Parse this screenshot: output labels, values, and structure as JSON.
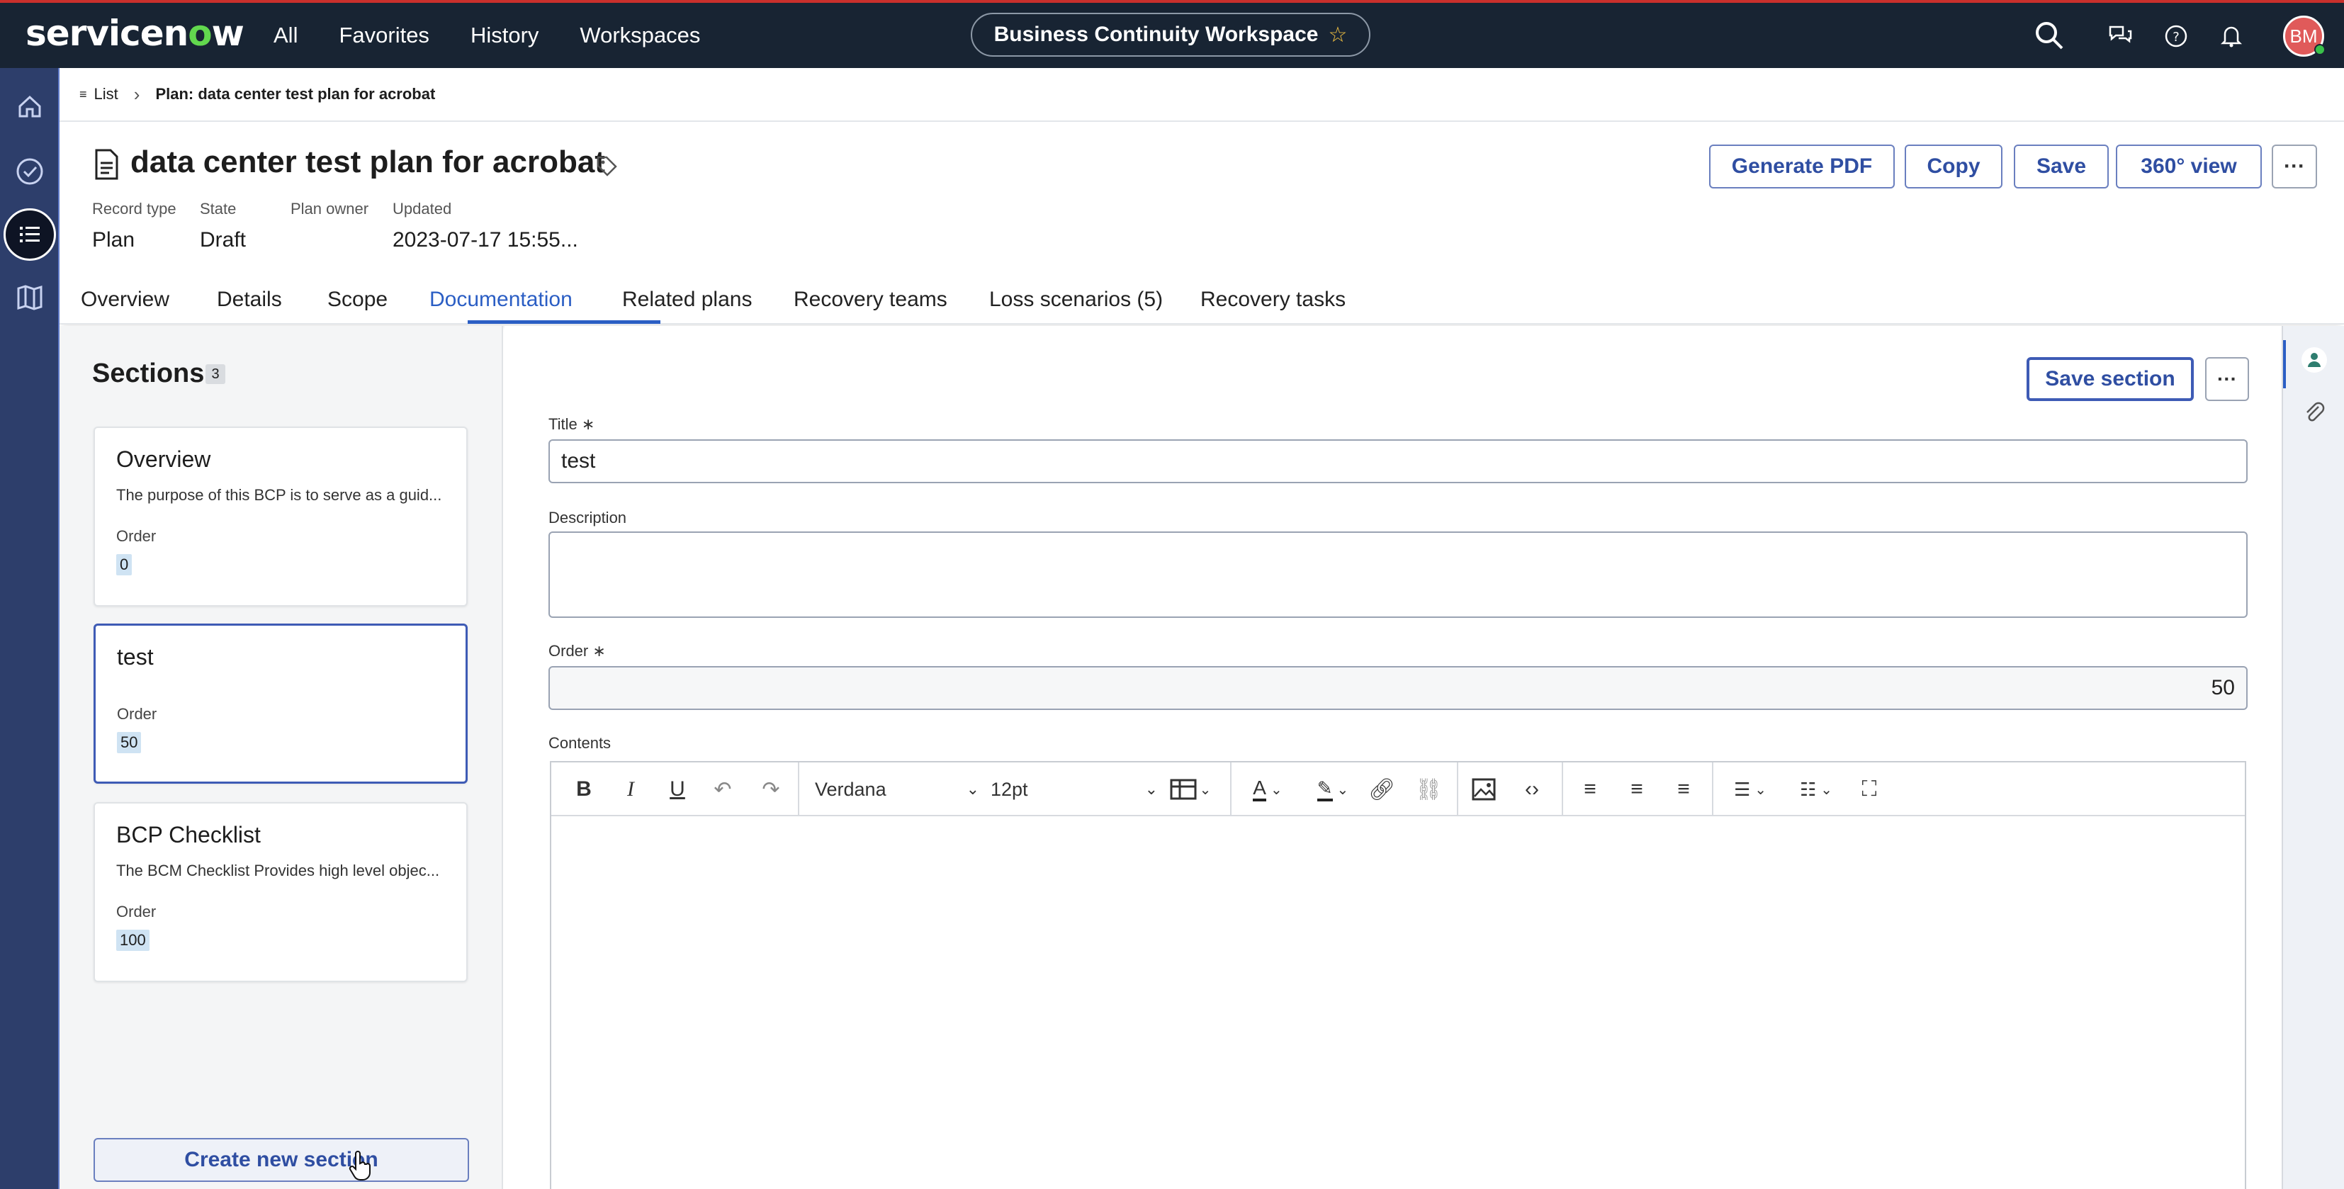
{
  "topbar": {
    "logo_text": "servicenow",
    "nav": [
      "All",
      "Favorites",
      "History",
      "Workspaces"
    ],
    "workspace": "Business Continuity Workspace",
    "avatar_initials": "BM"
  },
  "breadcrumb": {
    "list_label": "List",
    "current": "Plan: data center test plan for acrobat"
  },
  "record": {
    "title": "data center test plan for acrobat",
    "meta": [
      {
        "label": "Record type",
        "value": "Plan"
      },
      {
        "label": "State",
        "value": "Draft"
      },
      {
        "label": "Plan owner",
        "value": ""
      },
      {
        "label": "Updated",
        "value": "2023-07-17 15:55..."
      }
    ],
    "actions": {
      "generate_pdf": "Generate PDF",
      "copy": "Copy",
      "save": "Save",
      "view360": "360° view",
      "more": "···"
    }
  },
  "tabs": [
    "Overview",
    "Details",
    "Scope",
    "Documentation",
    "Related plans",
    "Recovery teams",
    "Loss scenarios (5)",
    "Recovery tasks"
  ],
  "sections": {
    "title": "Sections",
    "count": "3",
    "items": [
      {
        "title": "Overview",
        "desc": "The purpose of this BCP is to serve as a guid...",
        "order_label": "Order",
        "order": "0"
      },
      {
        "title": "test",
        "desc": "",
        "order_label": "Order",
        "order": "50"
      },
      {
        "title": "BCP Checklist",
        "desc": "The BCM Checklist Provides high level objec...",
        "order_label": "Order",
        "order": "100"
      }
    ],
    "create_label": "Create new section"
  },
  "form": {
    "save_section": "Save section",
    "more": "···",
    "title_label": "Title",
    "title_value": "test",
    "description_label": "Description",
    "description_value": "",
    "order_label": "Order",
    "order_value": "50",
    "contents_label": "Contents",
    "required_mark": "∗",
    "toolbar": {
      "font": "Verdana",
      "size": "12pt"
    }
  },
  "colors": {
    "topbar": "#182433",
    "rail": "#2d3e6b",
    "accent": "#2b5ec4",
    "button_text": "#2f4ea2"
  }
}
